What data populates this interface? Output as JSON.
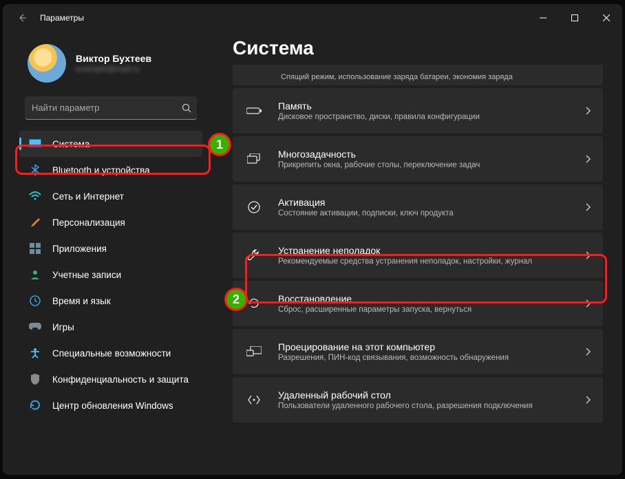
{
  "window": {
    "title": "Параметры"
  },
  "user": {
    "name": "Виктор Бухтеев",
    "email": "example@mail.ru"
  },
  "search": {
    "placeholder": "Найти параметр"
  },
  "sidebar": {
    "items": [
      {
        "label": "Система"
      },
      {
        "label": "Bluetooth и устройства"
      },
      {
        "label": "Сеть и Интернет"
      },
      {
        "label": "Персонализация"
      },
      {
        "label": "Приложения"
      },
      {
        "label": "Учетные записи"
      },
      {
        "label": "Время и язык"
      },
      {
        "label": "Игры"
      },
      {
        "label": "Специальные возможности"
      },
      {
        "label": "Конфиденциальность и защита"
      },
      {
        "label": "Центр обновления Windows"
      }
    ]
  },
  "page": {
    "title": "Система"
  },
  "rows": [
    {
      "desc": "Спящий режим, использование заряда батареи, экономия заряда"
    },
    {
      "title": "Память",
      "desc": "Дисковое пространство, диски, правила конфигурации"
    },
    {
      "title": "Многозадачность",
      "desc": "Прикрепить окна, рабочие столы, переключение задач"
    },
    {
      "title": "Активация",
      "desc": "Состояние активации, подписки, ключ продукта"
    },
    {
      "title": "Устранение неполадок",
      "desc": "Рекомендуемые средства устранения неполадок, настройки, журнал"
    },
    {
      "title": "Восстановление",
      "desc": "Сброс, расширенные параметры запуска, вернуться"
    },
    {
      "title": "Проецирование на этот компьютер",
      "desc": "Разрешения, ПИН-код связывания, возможность обнаружения"
    },
    {
      "title": "Удаленный рабочий стол",
      "desc": "Пользователи удаленного рабочего стола, разрешения подключения"
    }
  ],
  "markers": {
    "one": "1",
    "two": "2"
  }
}
